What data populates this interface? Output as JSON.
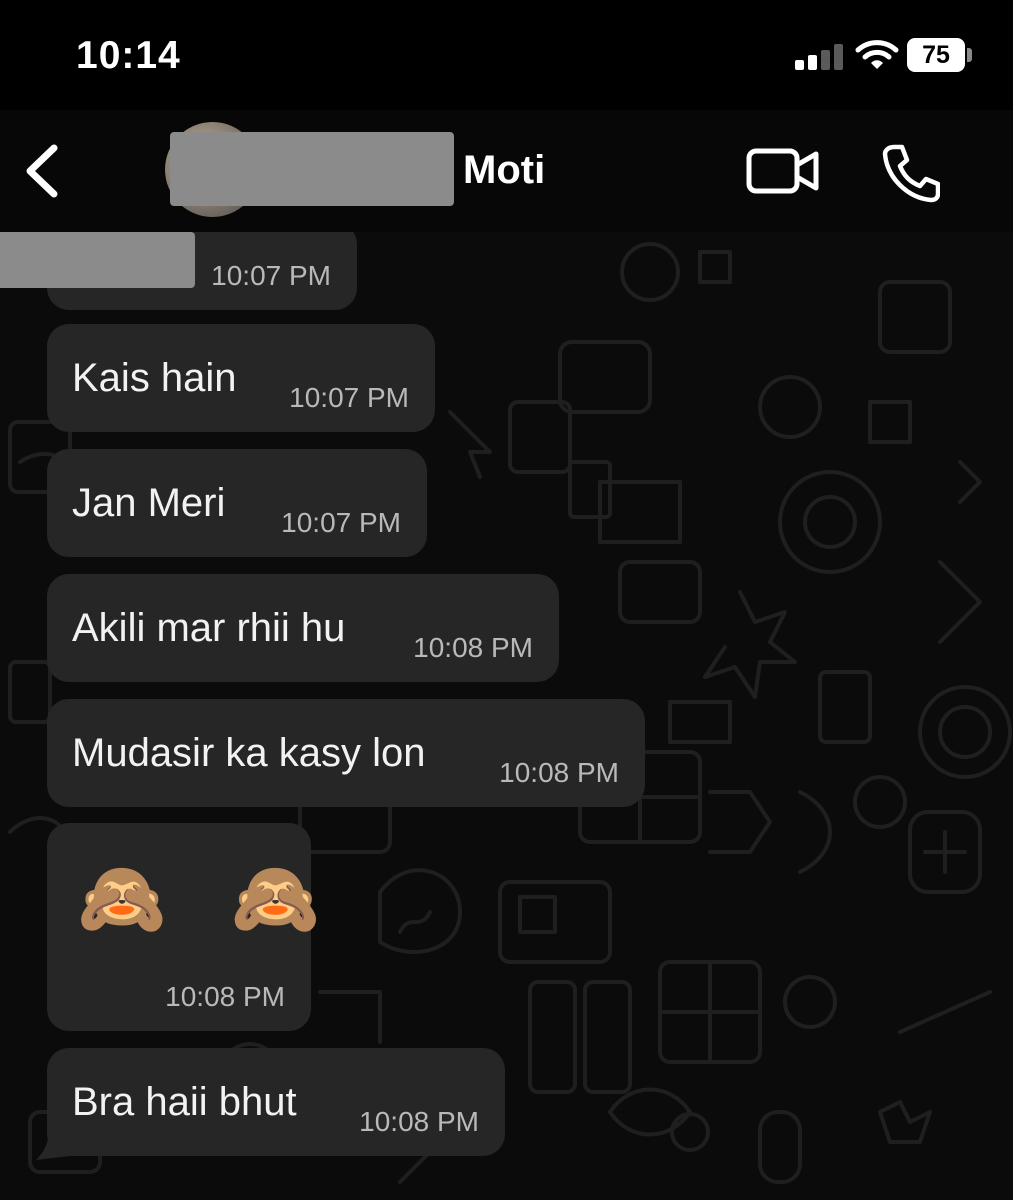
{
  "status_bar": {
    "time": "10:14",
    "battery": "75"
  },
  "header": {
    "contact_name": "Moti",
    "back_icon": "chevron-left-icon",
    "video_icon": "video-camera-icon",
    "call_icon": "phone-icon"
  },
  "messages": [
    {
      "text": "",
      "time": "10:07 PM"
    },
    {
      "text": "Kais hain",
      "time": "10:07 PM"
    },
    {
      "text": "Jan Meri",
      "time": "10:07 PM"
    },
    {
      "text": "Akili mar rhii hu",
      "time": "10:08 PM"
    },
    {
      "text": "Mudasir ka kasy lon",
      "time": "10:08 PM"
    },
    {
      "text": "🙈 🙈",
      "time": "10:08 PM"
    },
    {
      "text": "Bra haii bhut",
      "time": "10:08 PM"
    }
  ],
  "colors": {
    "background": "#000000",
    "bubble": "#262626",
    "timestamp": "#b9b9b9",
    "redaction": "#8b8b8b"
  }
}
